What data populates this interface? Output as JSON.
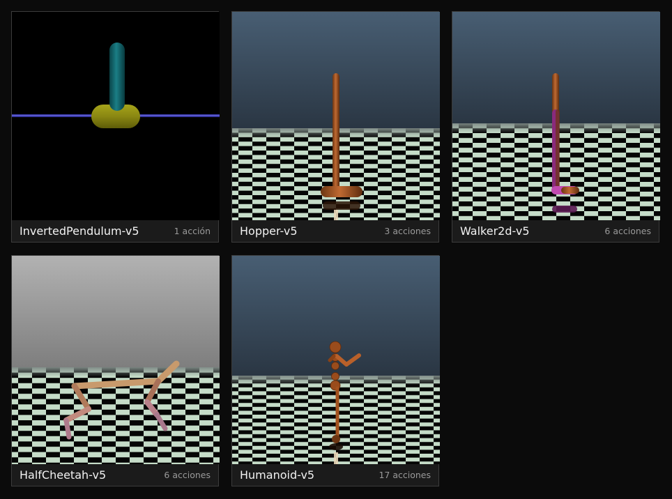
{
  "environments": [
    {
      "name": "InvertedPendulum-v5",
      "actions": "1 acción"
    },
    {
      "name": "Hopper-v5",
      "actions": "3 acciones"
    },
    {
      "name": "Walker2d-v5",
      "actions": "6 acciones"
    },
    {
      "name": "HalfCheetah-v5",
      "actions": "6 acciones"
    },
    {
      "name": "Humanoid-v5",
      "actions": "17 acciones"
    }
  ]
}
